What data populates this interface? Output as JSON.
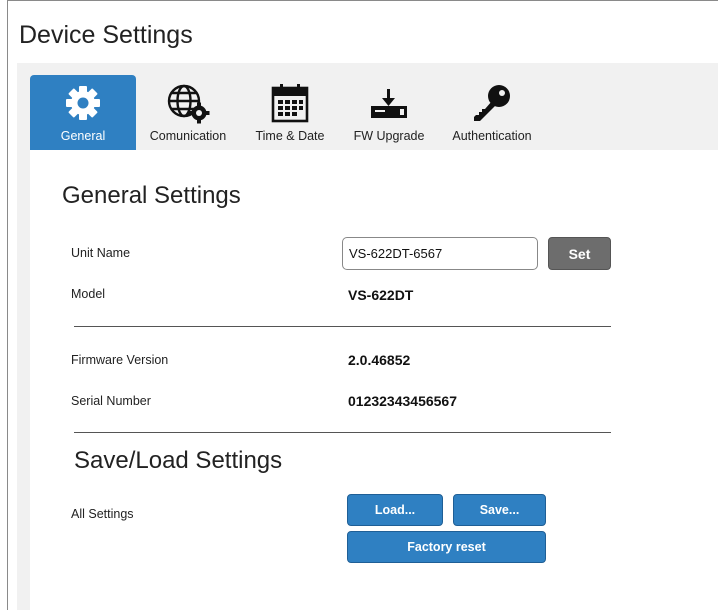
{
  "page_title": "Device Settings",
  "tabs": [
    {
      "label": "General",
      "icon": "gear-icon",
      "active": true
    },
    {
      "label": "Comunication",
      "icon": "globe-gear-icon",
      "active": false
    },
    {
      "label": "Time & Date",
      "icon": "calendar-icon",
      "active": false
    },
    {
      "label": "FW Upgrade",
      "icon": "download-device-icon",
      "active": false
    },
    {
      "label": "Authentication",
      "icon": "key-icon",
      "active": false
    }
  ],
  "general": {
    "heading": "General Settings",
    "unit_name_label": "Unit Name",
    "unit_name_value": "VS-622DT-6567",
    "set_button": "Set",
    "model_label": "Model",
    "model_value": "VS-622DT",
    "firmware_label": "Firmware Version",
    "firmware_value": "2.0.46852",
    "serial_label": "Serial Number",
    "serial_value": "01232343456567"
  },
  "save_load": {
    "heading": "Save/Load Settings",
    "all_settings_label": "All Settings",
    "load_button": "Load...",
    "save_button": "Save...",
    "factory_reset_button": "Factory reset"
  },
  "colors": {
    "accent": "#2f80c2",
    "set_button": "#6d6d6d",
    "panel_bg": "#f1f1f1"
  }
}
